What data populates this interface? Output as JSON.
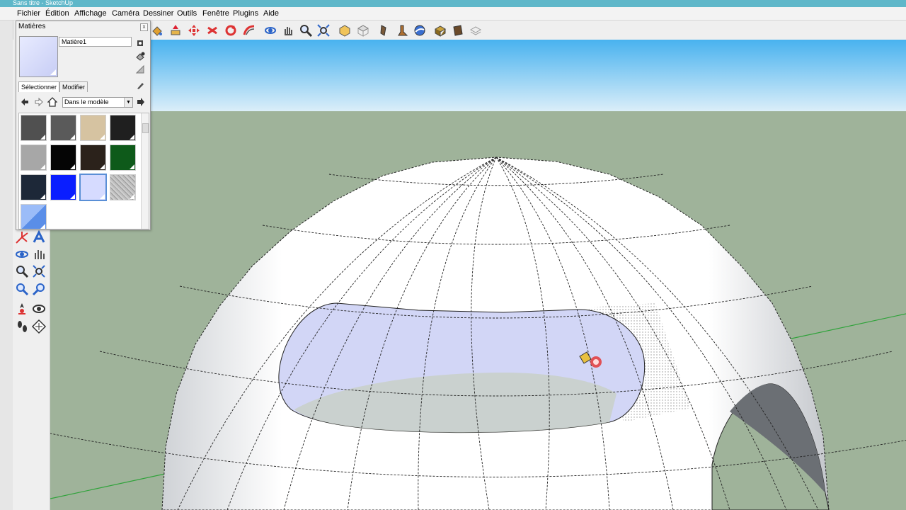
{
  "window": {
    "title": "Sans titre - SketchUp"
  },
  "menu": [
    "Fichier",
    "Édition",
    "Affichage",
    "Caméra",
    "Dessiner",
    "Outils",
    "Fenêtre",
    "Plugins",
    "Aide"
  ],
  "materials_panel": {
    "title": "Matières",
    "close_glyph": "x",
    "material_name": "Matière1",
    "tabs": [
      "Sélectionner",
      "Modifier"
    ],
    "library_select": "Dans le modèle",
    "swatch_colors": [
      "#505050",
      "#5a5a5a",
      "#d6c3a1",
      "#1f1f1f",
      "#a7a7a7",
      "#050505",
      "#2b221b",
      "#0e5a1a",
      "#1d2838",
      "#0a1eff",
      "#d6dbff",
      "#b8b8b8",
      "#6a9df2"
    ],
    "selected_swatch_index": 10
  },
  "toolbar_icons": [
    "paint-bucket-icon",
    "push-pull-icon",
    "move-icon",
    "rotate-icon",
    "follow-me-icon",
    "orbit-icon",
    "pan-icon",
    "zoom-icon",
    "zoom-extents-icon",
    "iso-view-icon",
    "top-view-icon",
    "front-view-icon",
    "walk-icon",
    "look-around-icon",
    "section-icon",
    "component-icon",
    "group-icon",
    "layers-icon"
  ],
  "left_tool_icons": [
    "axes-icon",
    "text-3d-icon",
    "orbit-icon",
    "pan-icon",
    "zoom-icon",
    "zoom-extents-icon",
    "previous-view-icon",
    "next-view-icon",
    "position-camera-icon",
    "look-around-icon",
    "walk-icon",
    "section-plane-icon"
  ],
  "colors": {
    "sky_top": "#48b2ef",
    "sky_bottom": "#dbeef9",
    "ground": "#9fb39a",
    "dome_face": "#ffffff",
    "hole_face": "#d2d6f6",
    "axis_green": "#2fa33a",
    "cursor_red": "#e43a3a"
  }
}
